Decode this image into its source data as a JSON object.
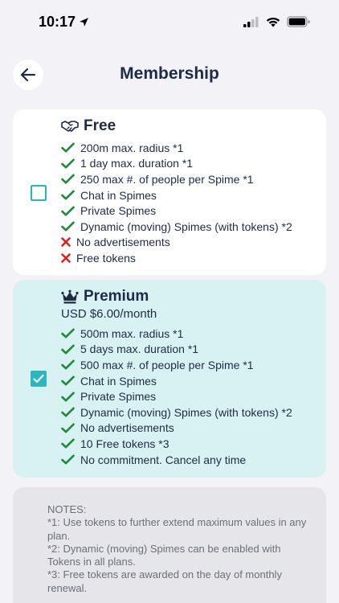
{
  "status_bar": {
    "time": "10:17",
    "icons": [
      "location-arrow-icon",
      "signal-icon",
      "wifi-icon",
      "battery-icon"
    ]
  },
  "header": {
    "title": "Membership",
    "back_icon": "arrow-left-icon"
  },
  "plans": [
    {
      "name": "Free",
      "icon": "handshake-icon",
      "selected": false,
      "features": [
        {
          "text": "200m max. radius *1",
          "included": true
        },
        {
          "text": "1 day max. duration *1",
          "included": true
        },
        {
          "text": "250 max #. of people per Spime *1",
          "included": true
        },
        {
          "text": "Chat in Spimes",
          "included": true
        },
        {
          "text": "Private Spimes",
          "included": true
        },
        {
          "text": "Dynamic (moving) Spimes (with tokens) *2",
          "included": true
        },
        {
          "text": "No advertisements",
          "included": false
        },
        {
          "text": "Free tokens",
          "included": false
        }
      ]
    },
    {
      "name": "Premium",
      "icon": "crown-icon",
      "price": "USD $6.00/month",
      "selected": true,
      "features": [
        {
          "text": "500m max. radius *1",
          "included": true
        },
        {
          "text": "5 days max. duration *1",
          "included": true
        },
        {
          "text": "500 max #. of people per Spime *1",
          "included": true
        },
        {
          "text": "Chat in Spimes",
          "included": true
        },
        {
          "text": "Private Spimes",
          "included": true
        },
        {
          "text": "Dynamic (moving) Spimes (with tokens) *2",
          "included": true
        },
        {
          "text": "No advertisements",
          "included": true
        },
        {
          "text": "10 Free tokens *3",
          "included": true
        },
        {
          "text": "No commitment. Cancel any time",
          "included": true
        }
      ]
    }
  ],
  "notes": [
    "NOTES:",
    "*1: Use tokens to further extend maximum values in any plan.",
    "*2: Dynamic (moving) Spimes can be enabled with Tokens in all plans.",
    "*3: Free tokens are awarded on the day of monthly renewal."
  ],
  "colors": {
    "accent": "#2ab7bd",
    "check": "#1f8a3a",
    "cross": "#e0211b",
    "title": "#1f2a44",
    "premium_bg": "#d8f2f4"
  }
}
